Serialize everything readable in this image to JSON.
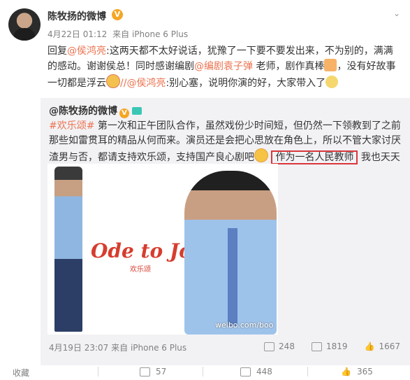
{
  "post": {
    "username": "陈牧扬的微博",
    "verified_badge": "V",
    "time": "4月22日 01:12",
    "source": "来自 iPhone 6 Plus",
    "text_parts": [
      "回复",
      "@侯鸿亮",
      ":这两天都不太好说话，犹豫了一下要不要发出来，不为别的，满满的感动。谢谢侯总！同时感谢编剧",
      "@编剧袁子弹",
      "老师，剧作真棒",
      "，没有好故事一切都是浮云",
      "//",
      "@侯鸿亮",
      ":别心塞，说明你演的好，大家带入了"
    ]
  },
  "repost": {
    "author": "@陈牧扬的微博",
    "hashtag": "#欢乐颂#",
    "text_1": "第一次和正午团队合作，虽然戏份少时间短，但仍然一下领教到了之前那些如雷贯耳的精品从何而来。演员还是会把心思放在角色上，所以不管大家讨厌渣男与否，都请支持欢乐颂，支持国产良心剧吧",
    "highlight": "作为一名人民教师",
    "text_2": "我也天天守着看呢",
    "logo_text": "Ode to Joy",
    "logo_sub": "欢乐颂",
    "watermark": "weibo.com/boo",
    "time": "4月19日 23:07",
    "source": "来自 iPhone 6 Plus",
    "reposts": "248",
    "comments": "1819",
    "likes": "1667"
  },
  "bottom_bar": {
    "favorite_label": "收藏",
    "reposts": "57",
    "comments": "448",
    "likes": "365"
  },
  "icons": [
    "chevron-down-icon",
    "verified-icon",
    "camera-icon",
    "repost-icon",
    "comment-icon",
    "like-icon",
    "emoji-icon"
  ]
}
